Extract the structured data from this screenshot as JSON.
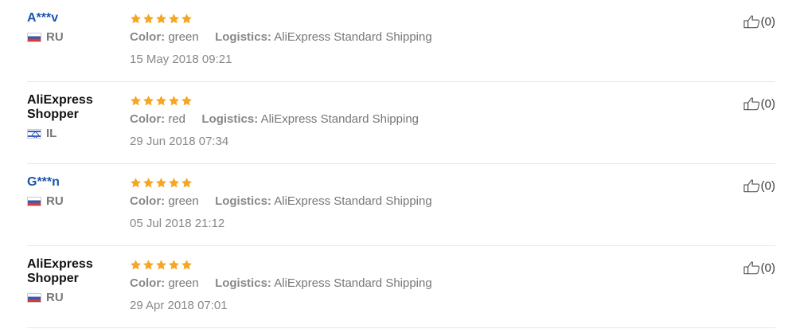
{
  "reviews": [
    {
      "user": "A***v",
      "user_is_link": true,
      "country_code": "ru",
      "country": "RU",
      "rating": 5,
      "color_key": "Color:",
      "color": "green",
      "logistics_key": "Logistics:",
      "logistics": "AliExpress Standard Shipping",
      "date": "15 May 2018 09:21",
      "helpful": "(0)"
    },
    {
      "user": "AliExpress Shopper",
      "user_is_link": false,
      "country_code": "il",
      "country": "IL",
      "rating": 5,
      "color_key": "Color:",
      "color": "red",
      "logistics_key": "Logistics:",
      "logistics": "AliExpress Standard Shipping",
      "date": "29 Jun 2018 07:34",
      "helpful": "(0)"
    },
    {
      "user": "G***n",
      "user_is_link": true,
      "country_code": "ru",
      "country": "RU",
      "rating": 5,
      "color_key": "Color:",
      "color": "green",
      "logistics_key": "Logistics:",
      "logistics": "AliExpress Standard Shipping",
      "date": "05 Jul 2018 21:12",
      "helpful": "(0)"
    },
    {
      "user": "AliExpress Shopper",
      "user_is_link": false,
      "country_code": "ru",
      "country": "RU",
      "rating": 5,
      "color_key": "Color:",
      "color": "green",
      "logistics_key": "Logistics:",
      "logistics": "AliExpress Standard Shipping",
      "date": "29 Apr 2018 07:01",
      "helpful": "(0)"
    }
  ],
  "colors": {
    "star": "#f5a623",
    "link": "#1a55a8"
  },
  "icons": {
    "star": "star-icon",
    "helpful": "thumbs-up-icon"
  }
}
